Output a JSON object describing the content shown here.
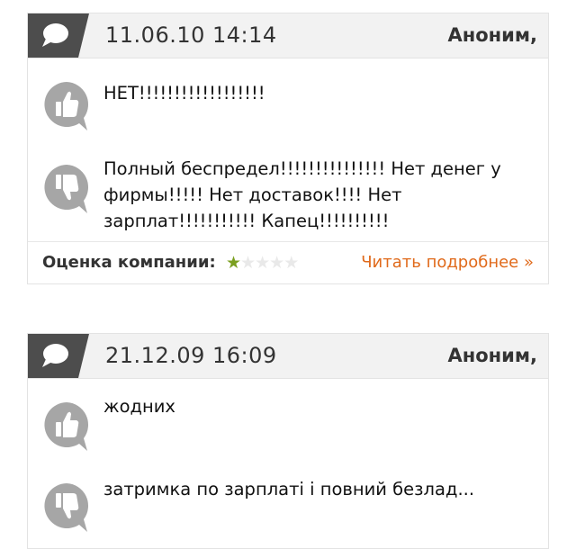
{
  "reviews": [
    {
      "date": "11.06.10 14:14",
      "author": "Аноним,",
      "pros": "НЕТ!!!!!!!!!!!!!!!!!!",
      "cons": "Полный беспредел!!!!!!!!!!!!!!! Нет денег у фирмы!!!!! Нет доставок!!!! Нет зарплат!!!!!!!!!!! Капец!!!!!!!!!!",
      "rating_label": "Оценка компании:",
      "rating": 1,
      "rating_max": 5,
      "read_more": "Читать подробнее »"
    },
    {
      "date": "21.12.09 16:09",
      "author": "Аноним,",
      "pros": "жодних",
      "cons": "затримка по зарплаті і повний безлад..."
    }
  ],
  "icons": {
    "comment": "comment-bubble-icon",
    "pros": "thumbs-up-icon",
    "cons": "thumbs-down-icon",
    "star": "star-icon"
  },
  "colors": {
    "tab_dark": "#4d4d4d",
    "thumb_gray": "#999999",
    "star_on": "#7a9f1f",
    "star_off": "#e9e9e9",
    "link": "#e06a1b"
  }
}
